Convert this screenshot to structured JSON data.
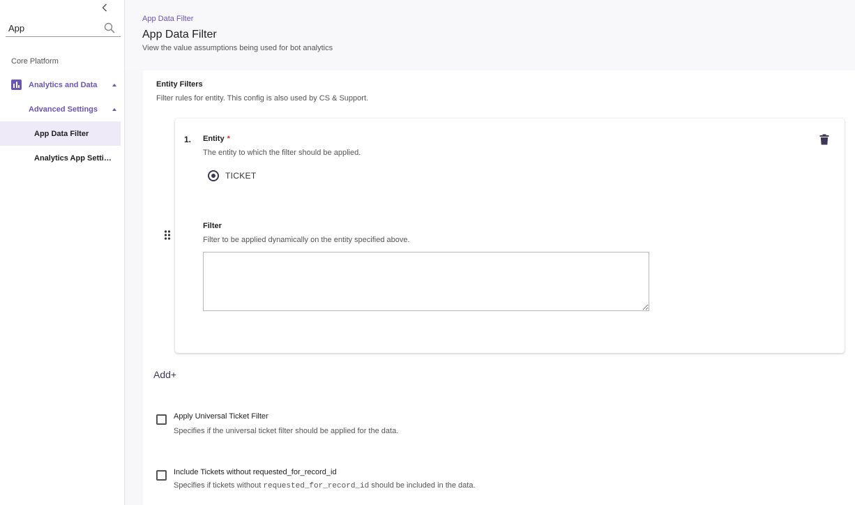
{
  "sidebar": {
    "collapse_icon": "chevron-left-icon",
    "search": {
      "value": "App",
      "icon": "search-icon"
    },
    "section_label": "Core Platform",
    "items": [
      {
        "label": "Analytics and Data",
        "icon": "bar-chart-icon",
        "expanded": true
      },
      {
        "label": "Advanced Settings",
        "expanded": true
      },
      {
        "label": "App Data Filter",
        "selected": true
      },
      {
        "label": "Analytics App Settings"
      }
    ]
  },
  "header": {
    "breadcrumb": "App Data Filter",
    "title": "App Data Filter",
    "subtitle": "View the value assumptions being used for bot analytics"
  },
  "entity_filters": {
    "title": "Entity Filters",
    "description": "Filter rules for entity. This config is also used by CS & Support.",
    "cards": [
      {
        "index": "1.",
        "entity_label": "Entity",
        "required_mark": "*",
        "entity_desc": "The entity to which the filter should be applied.",
        "entity_option": "TICKET",
        "filter_label": "Filter",
        "filter_desc": "Filter to be applied dynamically on the entity specified above.",
        "filter_value": ""
      }
    ],
    "add_label": "Add"
  },
  "options": {
    "universal": {
      "label": "Apply Universal Ticket Filter",
      "desc": "Specifies if the universal ticket filter should be applied for the data.",
      "checked": false
    },
    "include_tickets": {
      "label": "Include Tickets without requested_for_record_id",
      "desc_pre": "Specifies if tickets without",
      "desc_code": "requested_for_record_id",
      "desc_post": "should be included in the data.",
      "checked": false
    }
  },
  "colors": {
    "accent": "#6b55b5",
    "selected_bg": "#efeaf8",
    "dark_icon": "#3d3656"
  }
}
